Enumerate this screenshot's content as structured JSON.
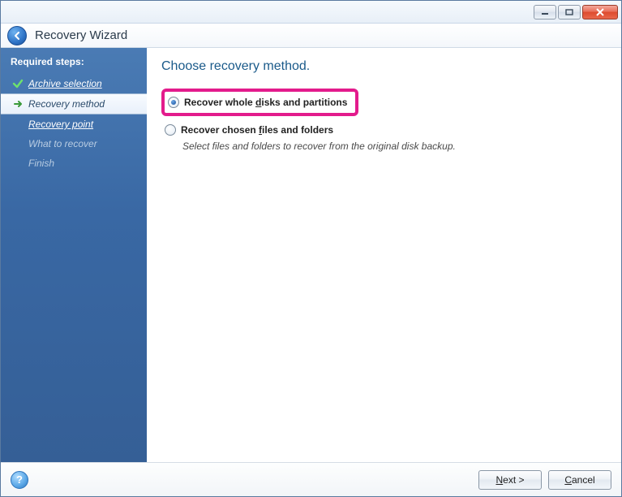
{
  "window": {
    "title": "Recovery Wizard"
  },
  "sidebar": {
    "header": "Required steps:",
    "steps": {
      "archive_selection": "Archive selection",
      "recovery_method": "Recovery method",
      "recovery_point": "Recovery point",
      "what_to_recover": "What to recover",
      "finish": "Finish"
    }
  },
  "main": {
    "title": "Choose recovery method.",
    "option1": {
      "label_pre": "Recover whole ",
      "label_ul": "d",
      "label_post": "isks and partitions",
      "selected": true
    },
    "option2": {
      "label_pre": "Recover chosen ",
      "label_ul": "f",
      "label_post": "iles and folders",
      "selected": false,
      "description": "Select files and folders to recover from the original disk backup."
    }
  },
  "footer": {
    "next_ul": "N",
    "next_post": "ext >",
    "cancel_ul": "C",
    "cancel_post": "ancel"
  }
}
